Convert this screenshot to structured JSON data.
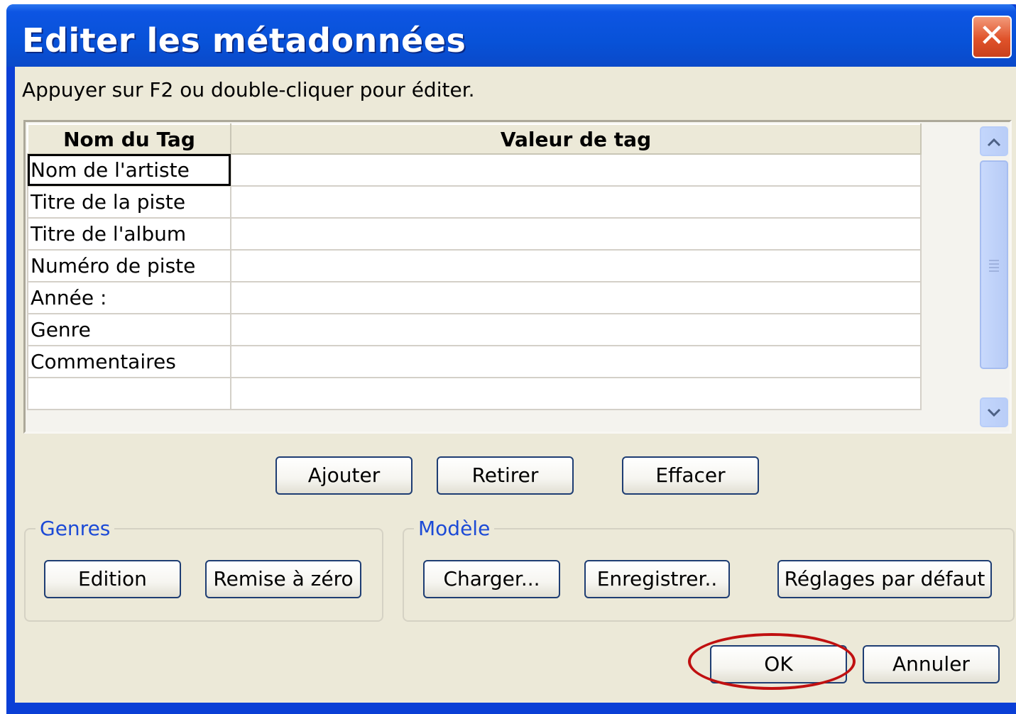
{
  "window": {
    "title": "Editer les métadonnées",
    "close_glyph": "✕"
  },
  "instruction": "Appuyer sur F2 ou double-cliquer pour éditer.",
  "table": {
    "headers": [
      "Nom du  Tag",
      "Valeur de tag"
    ],
    "rows": [
      {
        "name": "Nom de l'artiste",
        "value": ""
      },
      {
        "name": "Titre de la piste",
        "value": ""
      },
      {
        "name": "Titre de l'album",
        "value": ""
      },
      {
        "name": "Numéro de piste",
        "value": ""
      },
      {
        "name": "Année :",
        "value": ""
      },
      {
        "name": "Genre",
        "value": ""
      },
      {
        "name": "Commentaires",
        "value": ""
      },
      {
        "name": "",
        "value": ""
      }
    ]
  },
  "actions": {
    "add": "Ajouter",
    "remove": "Retirer",
    "clear": "Effacer"
  },
  "genres": {
    "legend": "Genres",
    "edit": "Edition",
    "reset": "Remise à zéro"
  },
  "model": {
    "legend": "Modèle",
    "load": "Charger...",
    "save": "Enregistrer..",
    "defaults": "Réglages par défaut"
  },
  "dialog": {
    "ok": "OK",
    "cancel": "Annuler"
  },
  "colors": {
    "titlebar": "#0852d8",
    "face": "#ece9d8",
    "legend": "#1c4ad6",
    "annotation": "#c01010"
  }
}
